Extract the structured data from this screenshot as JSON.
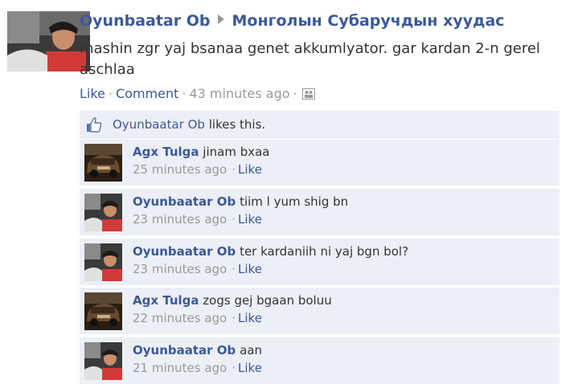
{
  "post": {
    "author": "Oyunbaatar Ob",
    "group": "Монголын Субаручдын хуудас",
    "text": "mashin zgr yaj bsanaa genet akkumlyator. gar kardan 2-n gerel aschlaa",
    "actions": {
      "like": "Like",
      "comment": "Comment",
      "time": "43 minutes ago",
      "separator": "·"
    }
  },
  "likes": {
    "name": "Oyunbaatar Ob",
    "text": "likes this."
  },
  "comments": [
    {
      "author": "Agx Tulga",
      "text": "jinam bxaa",
      "time": "25 minutes ago",
      "like": "Like",
      "avatar": "car-photo"
    },
    {
      "author": "Oyunbaatar Ob",
      "text": "tiim l yum shig bn",
      "time": "23 minutes ago",
      "like": "Like",
      "avatar": "person-photo"
    },
    {
      "author": "Oyunbaatar Ob",
      "text": "ter kardaniih ni yaj bgn bol?",
      "time": "23 minutes ago",
      "like": "Like",
      "avatar": "person-photo"
    },
    {
      "author": "Agx Tulga",
      "text": "zogs gej bgaan boluu",
      "time": "22 minutes ago",
      "like": "Like",
      "avatar": "car-photo"
    },
    {
      "author": "Oyunbaatar Ob",
      "text": "aan",
      "time": "21 minutes ago",
      "like": "Like",
      "avatar": "person-photo"
    }
  ],
  "colors": {
    "link": "#3b5998",
    "meta": "#999999",
    "comment_bg": "#eceff5",
    "text": "#333333"
  },
  "icons": {
    "post_arrow": "right-triangle-arrow-icon",
    "audience": "group-audience-icon",
    "like": "thumbs-up-icon"
  }
}
